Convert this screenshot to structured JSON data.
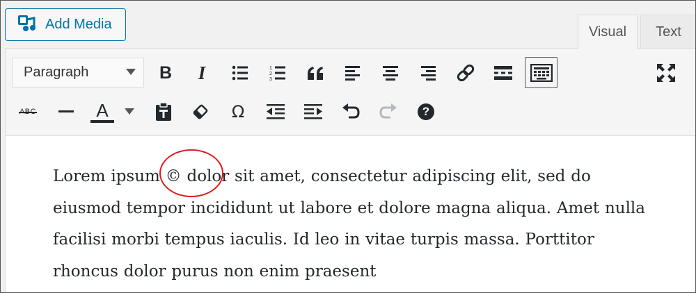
{
  "media": {
    "add_media_label": "Add Media"
  },
  "tabs": {
    "visual": "Visual",
    "text": "Text"
  },
  "toolbar": {
    "format_select": {
      "value": "Paragraph"
    },
    "row1": [
      "bold",
      "italic",
      "bulleted-list",
      "numbered-list",
      "blockquote",
      "align-left",
      "align-center",
      "align-right",
      "insert-link",
      "read-more",
      "toolbar-toggle",
      "fullscreen"
    ],
    "row2": [
      "strikethrough",
      "horizontal-line",
      "text-color",
      "paste-as-text",
      "clear-formatting",
      "special-character",
      "decrease-indent",
      "increase-indent",
      "undo",
      "redo",
      "keyboard-shortcuts"
    ],
    "glyphs": {
      "bold": "B",
      "italic": "I",
      "text_color": "A",
      "omega": "Ω",
      "strike": "ABC",
      "help": "?"
    }
  },
  "editor": {
    "segments": {
      "before": "Lorem ipsum ",
      "symbol": "©",
      "after": " dolor sit amet, consectetur adipiscing elit, sed do eiusmod tempor incididunt ut labore et dolore magna aliqua. Amet nulla facilisi morbi tempus iaculis. Id leo in vitae turpis massa. Porttitor rhoncus dolor purus non enim praesent"
    }
  },
  "colors": {
    "accent": "#0073aa",
    "annotation": "#e01b1b",
    "text": "#23282d"
  }
}
